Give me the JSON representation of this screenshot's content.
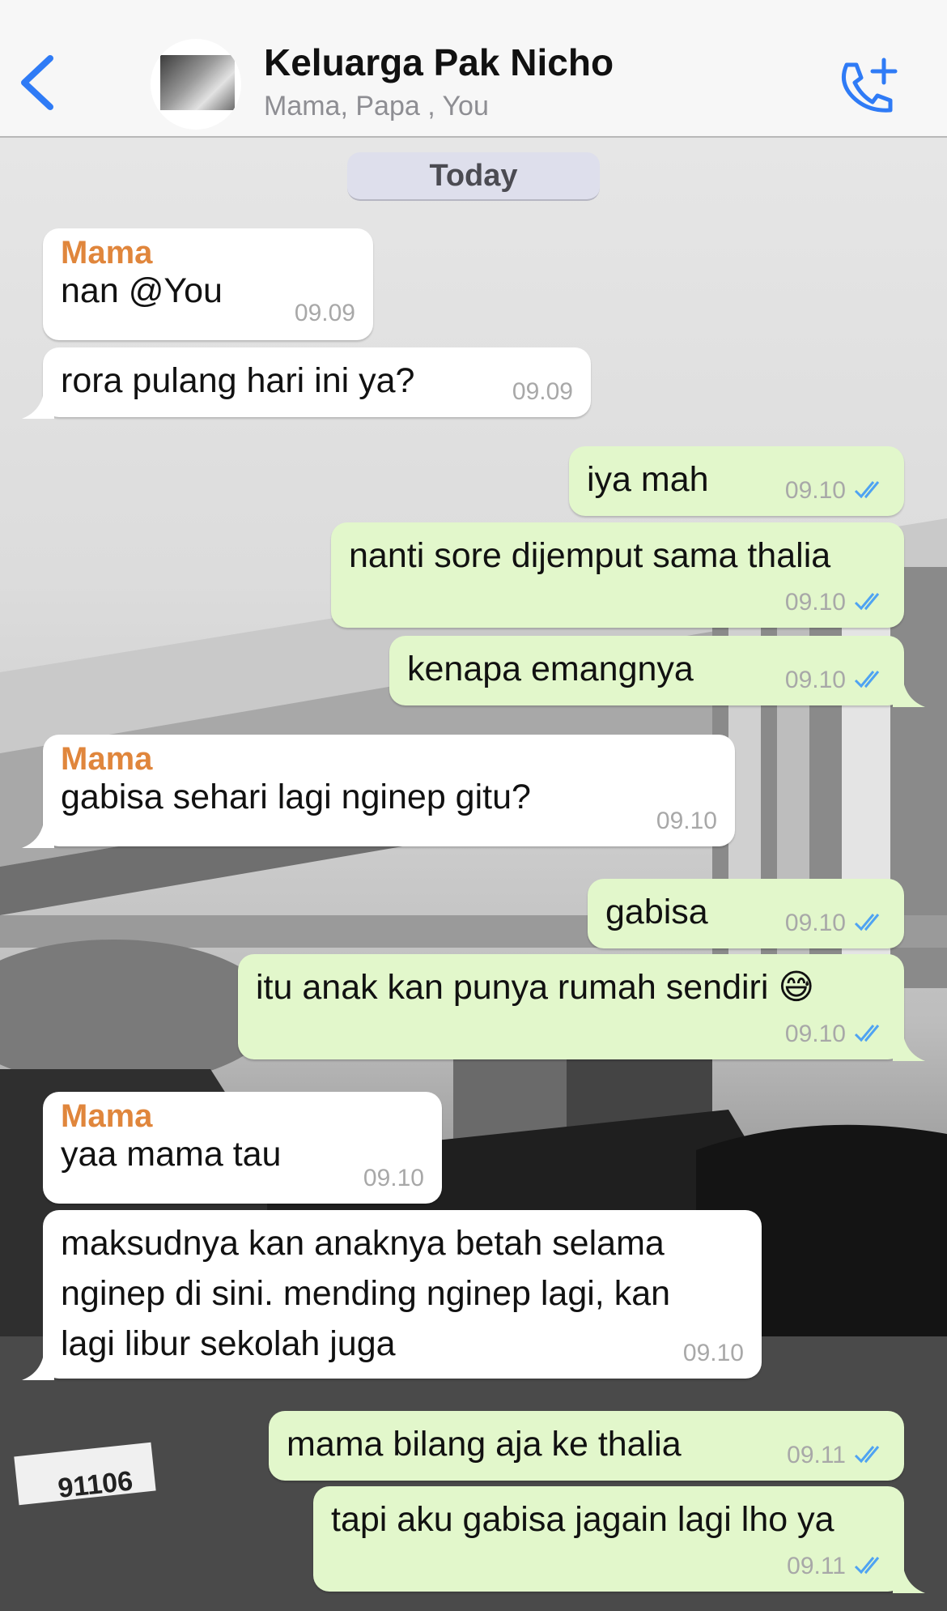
{
  "header": {
    "back_icon": "chevron-left-icon",
    "title": "Keluarga Pak Nicho",
    "subtitle": "Mama, Papa , You",
    "call_icon": "phone-plus-icon",
    "accent_color": "#2f7bf6"
  },
  "date_label": "Today",
  "colors": {
    "sender": "#e0863c",
    "outgoing_bubble": "#e2f7cb",
    "incoming_bubble": "#ffffff",
    "ticks": "#4fa3f2"
  },
  "messages": [
    {
      "dir": "in",
      "sender": "Mama",
      "text": "nan @You",
      "time": "09.09"
    },
    {
      "dir": "in",
      "text": "rora pulang hari ini ya?",
      "time": "09.09"
    },
    {
      "dir": "out",
      "text": "iya mah",
      "time": "09.10",
      "status": "read"
    },
    {
      "dir": "out",
      "text": "nanti sore dijemput sama thalia",
      "time": "09.10",
      "status": "read"
    },
    {
      "dir": "out",
      "text": "kenapa emangnya",
      "time": "09.10",
      "status": "read"
    },
    {
      "dir": "in",
      "sender": "Mama",
      "text": "gabisa sehari lagi nginep gitu?",
      "time": "09.10"
    },
    {
      "dir": "out",
      "text": "gabisa",
      "time": "09.10",
      "status": "read"
    },
    {
      "dir": "out",
      "text": "itu anak kan punya rumah sendiri 😅",
      "time": "09.10",
      "status": "read"
    },
    {
      "dir": "in",
      "sender": "Mama",
      "text": "yaa mama tau",
      "time": "09.10"
    },
    {
      "dir": "in",
      "text": "maksudnya kan anaknya betah selama\nnginep di sini. mending nginep lagi, kan\nlagi libur sekolah juga",
      "time": "09.10"
    },
    {
      "dir": "out",
      "text": "mama bilang aja ke thalia",
      "time": "09.11",
      "status": "read"
    },
    {
      "dir": "out",
      "text": "tapi aku gabisa jagain lagi lho ya",
      "time": "09.11",
      "status": "read"
    }
  ],
  "background": {
    "photo_plate_text": "91106"
  }
}
